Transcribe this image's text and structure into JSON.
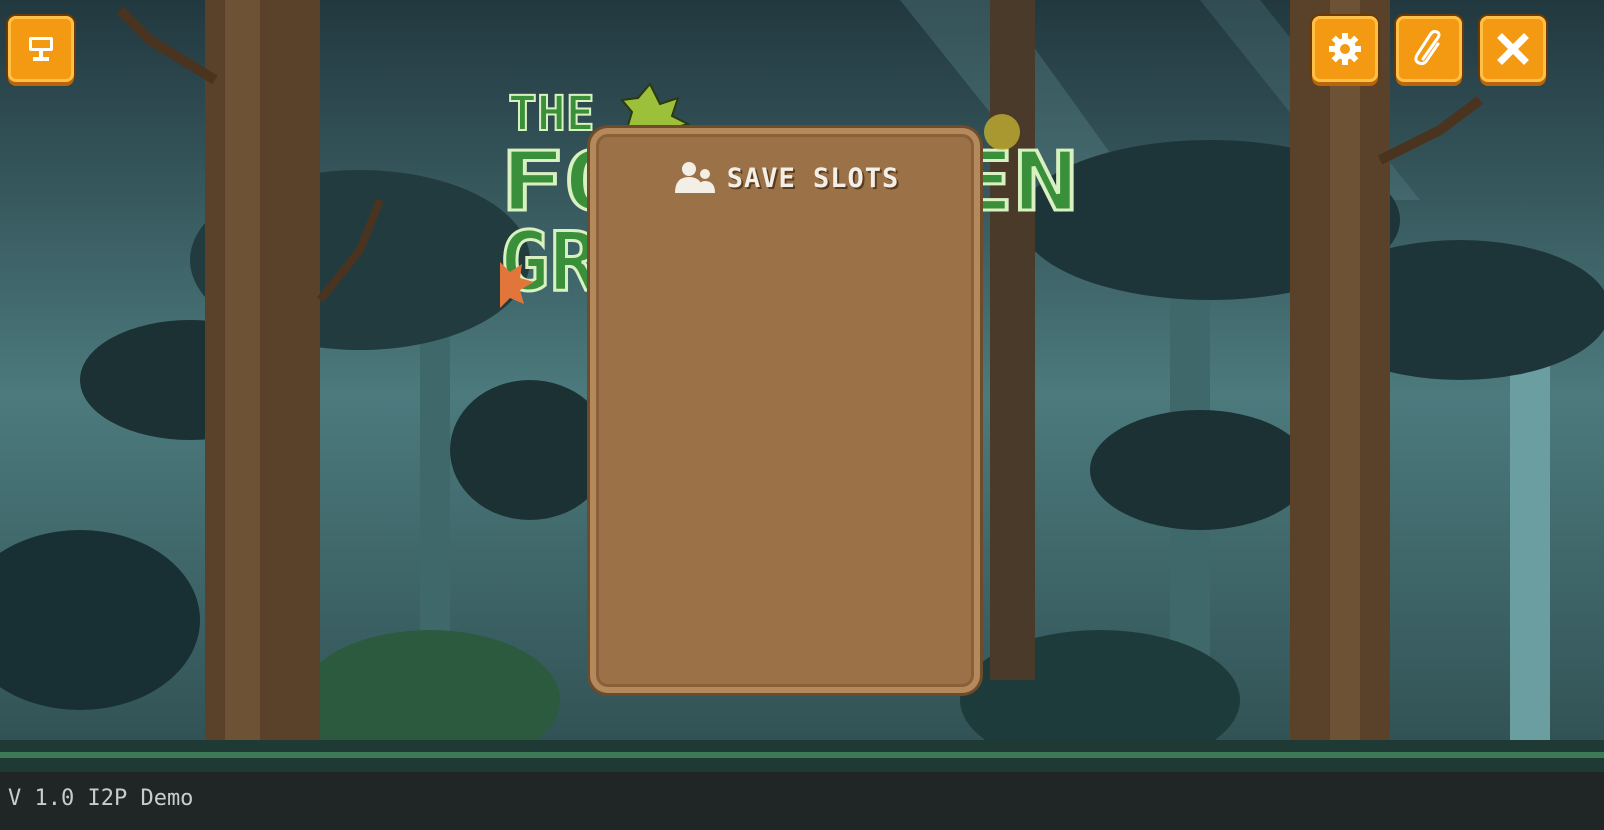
{
  "game": {
    "title_lines": [
      "THE",
      "FORGOTTEN",
      "GROVE"
    ]
  },
  "toolbar": {
    "left_icon": "trophy-icon",
    "right_icons": [
      "gear-icon",
      "paperclip-icon",
      "close-icon"
    ]
  },
  "panel": {
    "title": "SAVE SLOTS",
    "icon": "users-icon",
    "slots": []
  },
  "footer": {
    "version": "V 1.0 I2P Demo"
  },
  "colors": {
    "button": "#f39a12",
    "panel": "#9b7148",
    "logo_green": "#3a8f3a"
  }
}
